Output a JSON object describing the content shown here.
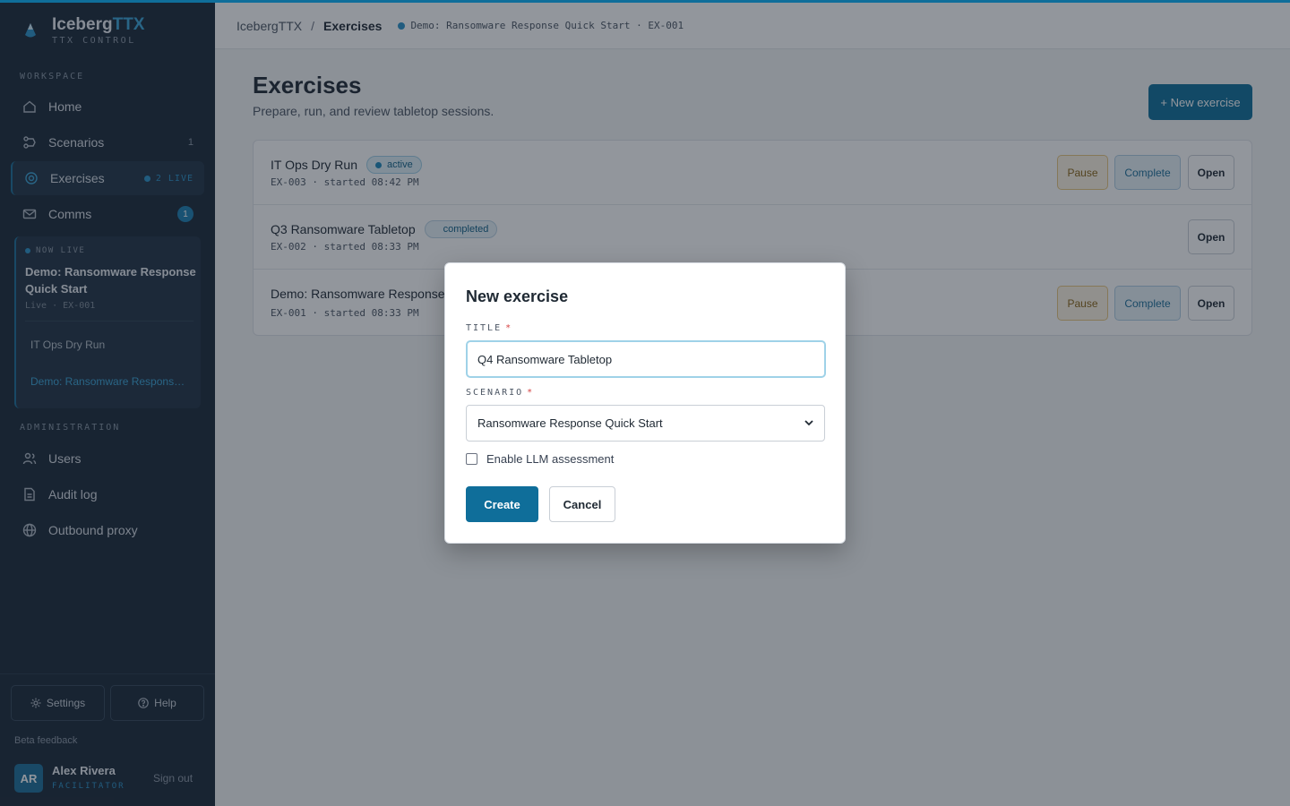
{
  "app": {
    "name_part1": "Iceberg",
    "name_part2": "TTX",
    "subtitle": "TTX CONTROL",
    "accent_color": "#0f6e9a"
  },
  "sidebar": {
    "workspace_label": "WORKSPACE",
    "nav": [
      {
        "label": "Home",
        "icon": "home-icon"
      },
      {
        "label": "Scenarios",
        "icon": "scenarios-icon",
        "count": "1"
      },
      {
        "label": "Exercises",
        "icon": "target-icon",
        "live": "2 LIVE",
        "active": true
      },
      {
        "label": "Comms",
        "icon": "mail-icon",
        "badge": "1"
      }
    ],
    "live_card": {
      "tag": "NOW LIVE",
      "title": "Demo: Ransomware Response Quick Start",
      "meta": "Live · EX-001",
      "items": [
        "IT Ops Dry Run",
        "Demo: Ransomware Response Quick Start"
      ]
    },
    "admin_label": "ADMINISTRATION",
    "admin_nav": [
      {
        "label": "Users",
        "icon": "users-icon"
      },
      {
        "label": "Audit log",
        "icon": "document-icon"
      },
      {
        "label": "Outbound proxy",
        "icon": "globe-icon"
      }
    ],
    "settings_label": "Settings",
    "help_label": "Help",
    "beta_label": "Beta feedback",
    "user": {
      "initials": "AR",
      "name": "Alex Rivera",
      "role": "FACILITATOR",
      "signout": "Sign out"
    }
  },
  "topbar": {
    "crumb_root": "IcebergTTX",
    "crumb_sep": "/",
    "crumb_current": "Exercises",
    "live_text": "Demo: Ransomware Response Quick Start · EX-001"
  },
  "main": {
    "title": "Exercises",
    "subtitle": "Prepare, run, and review tabletop sessions.",
    "new_button": "+ New exercise",
    "exercises": [
      {
        "title": "IT Ops Dry Run",
        "status": "active",
        "meta": "EX-003 · started 08:42 PM",
        "pause": "Pause",
        "complete": "Complete",
        "open": "Open"
      },
      {
        "title": "Q3 Ransomware Tabletop",
        "status": "completed",
        "meta": "EX-002 · started 08:33 PM",
        "open": "Open"
      },
      {
        "title": "Demo: Ransomware Response Quick Start",
        "meta": "EX-001 · started 08:33 PM",
        "pause": "Pause",
        "complete": "Complete",
        "open": "Open"
      }
    ]
  },
  "modal": {
    "title": "New exercise",
    "title_label": "TITLE",
    "required_mark": "*",
    "title_value": "Q4 Ransomware Tabletop",
    "scenario_label": "SCENARIO",
    "scenario_value": "Ransomware Response Quick Start",
    "llm_label": "Enable LLM assessment",
    "llm_checked": false,
    "create": "Create",
    "cancel": "Cancel"
  }
}
